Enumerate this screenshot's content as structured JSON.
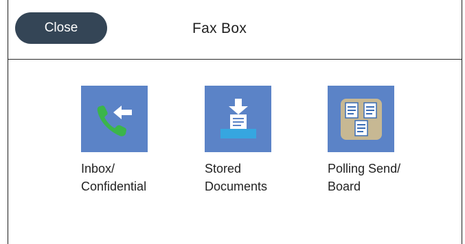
{
  "header": {
    "close_label": "Close",
    "title": "Fax Box"
  },
  "tiles": [
    {
      "line1": "Inbox/",
      "line2": "Confidential",
      "icon": "phone-incoming-icon"
    },
    {
      "line1": "Stored",
      "line2": "Documents",
      "icon": "download-tray-icon"
    },
    {
      "line1": "Polling Send/",
      "line2": "Board",
      "icon": "documents-board-icon"
    }
  ],
  "colors": {
    "close_button": "#344556",
    "tile_background": "#5b83c7",
    "phone_icon": "#3bb54a",
    "board_background": "#c7b893"
  }
}
